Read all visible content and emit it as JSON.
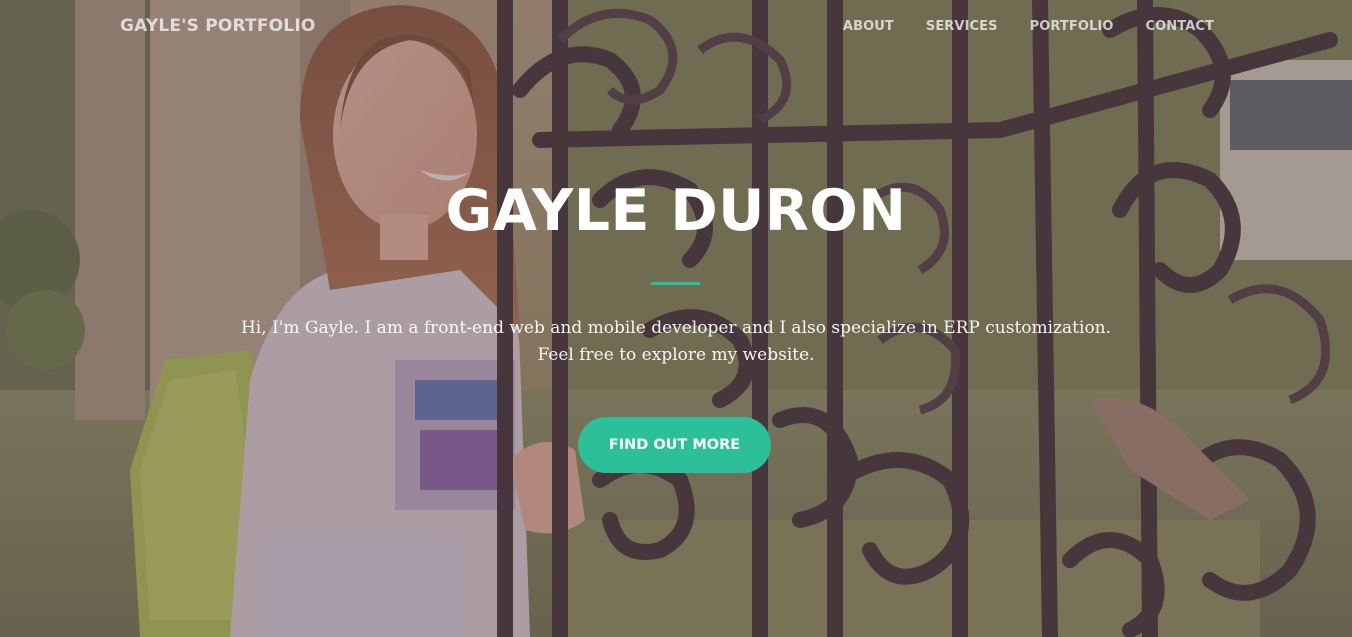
{
  "navbar": {
    "brand": "GAYLE'S PORTFOLIO",
    "links": [
      "ABOUT",
      "SERVICES",
      "PORTFOLIO",
      "CONTACT"
    ]
  },
  "hero": {
    "title": "GAYLE DURON",
    "lead": "Hi, I'm Gayle. I am a front-end web and mobile developer and I also specialize in ERP customization. Feel free to explore my website.",
    "cta_label": "FIND OUT MORE"
  },
  "colors": {
    "accent": "#2bbf9a",
    "overlay": "rgba(92,64,68,0.42)",
    "text": "#ffffff"
  }
}
